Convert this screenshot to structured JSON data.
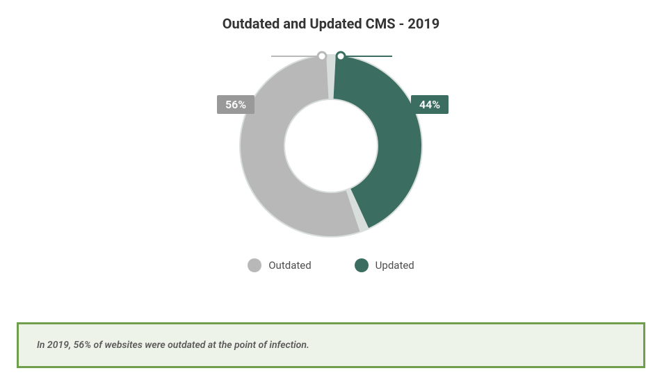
{
  "chart_data": {
    "type": "pie",
    "title": "Outdated and Updated CMS - 2019",
    "series": [
      {
        "name": "Outdated",
        "value": 56,
        "label": "56%",
        "color": "#b8b8b8"
      },
      {
        "name": "Updated",
        "value": 44,
        "label": "44%",
        "color": "#3b6e60"
      }
    ],
    "legend": [
      "Outdated",
      "Updated"
    ]
  },
  "caption": "In 2019, 56% of websites were outdated at the point of infection.",
  "colors": {
    "outdated": "#b8b8b8",
    "updated": "#3b6e60",
    "accent_green": "#6f9e4c",
    "caption_bg": "#eef3e9",
    "label_gray": "#999999"
  }
}
